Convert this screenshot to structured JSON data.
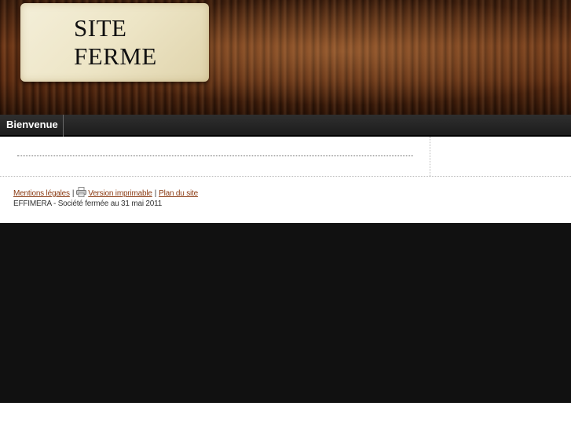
{
  "header": {
    "title_line1": "SITE",
    "title_line2": "FERME"
  },
  "nav": {
    "items": [
      {
        "label": "Bienvenue"
      }
    ]
  },
  "footer": {
    "links": {
      "legal": "Mentions légales",
      "print": "Version imprimable",
      "sitemap": "Plan du site"
    },
    "separator": "|",
    "print_icon": "printer-icon",
    "copyright": "EFFIMERA - Société fermée au 31 mai 2011"
  },
  "colors": {
    "link": "#8a3a12",
    "navbar": "#1c1c1c",
    "dark_area": "#111111"
  }
}
